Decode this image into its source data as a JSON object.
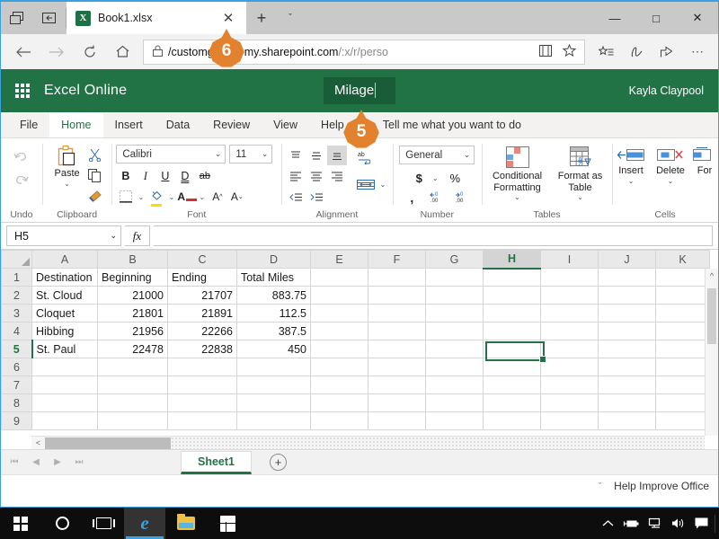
{
  "browser": {
    "tab": {
      "title": "Book1.xlsx",
      "icon": "excel-icon",
      "close": "✕"
    },
    "newtab_label": "+",
    "tab_menu_label": "ˇ",
    "window_controls": {
      "minimize": "—",
      "maximize": "□",
      "close": "✕"
    },
    "nav": {
      "back": "←",
      "forward": "→",
      "refresh": "↻",
      "home": "⌂"
    },
    "url": {
      "lock": "ὑ2",
      "domain": "/customguides-my.sharepoint.com",
      "path": "/:x/r/perso"
    },
    "url_icons": {
      "reading_view": "□",
      "favorite": "☆"
    },
    "toolbar_icons": {
      "favorites_list": "☆",
      "notes": "✎",
      "share": "⤴",
      "more": "⋯"
    }
  },
  "excel": {
    "brand": "Excel Online",
    "filename": "Milage",
    "user": "Kayla Claypool",
    "waffle": "app-launcher-icon",
    "tabs": [
      {
        "label": "File",
        "active": false
      },
      {
        "label": "Home",
        "active": true
      },
      {
        "label": "Insert",
        "active": false
      },
      {
        "label": "Data",
        "active": false
      },
      {
        "label": "Review",
        "active": false
      },
      {
        "label": "View",
        "active": false
      },
      {
        "label": "Help",
        "active": false
      }
    ],
    "tellme": "Tell me what you want to do",
    "ribbon": {
      "undo": {
        "label": "Undo",
        "undo_icon": "↶",
        "redo_icon": "↷"
      },
      "clipboard": {
        "label": "Clipboard",
        "paste": "Paste",
        "cut": "✂",
        "copy": "⧉",
        "format_painter": "✂"
      },
      "font": {
        "label": "Font",
        "family": "Calibri",
        "size": "11",
        "bold": "B",
        "italic": "I",
        "underline": "U",
        "double_underline": "D",
        "strikethrough": "ab",
        "borders": "▦",
        "fill_color": "A",
        "font_color": "A",
        "grow": "A",
        "shrink": "A"
      },
      "alignment": {
        "label": "Alignment",
        "top": "≡",
        "middle": "≡",
        "bottom": "≡",
        "left": "≡",
        "center": "≡",
        "right": "≡",
        "decrease_indent": "≡",
        "increase_indent": "≡",
        "wrap_text": "ab",
        "merge": "↔"
      },
      "number": {
        "label": "Number",
        "format": "General",
        "currency": "$",
        "percent": "%",
        "comma": ",",
        "increase_decimal": ".00",
        "decrease_decimal": ".00"
      },
      "tables": {
        "label": "Tables",
        "conditional_formatting": "Conditional Formatting",
        "format_as_table": "Format as Table"
      },
      "cells": {
        "label": "Cells",
        "insert": "Insert",
        "delete": "Delete",
        "format": "For"
      }
    },
    "formula_bar": {
      "name_box": "H5",
      "fx": "fx",
      "formula": ""
    },
    "grid": {
      "columns": [
        "A",
        "B",
        "C",
        "D",
        "E",
        "F",
        "G",
        "H",
        "I",
        "J",
        "K"
      ],
      "selected_column": "H",
      "selected_cell": "H5",
      "rows": [
        {
          "num": "1",
          "cells": [
            "Destination",
            "Beginning",
            "Ending",
            "Total Miles",
            "",
            "",
            "",
            "",
            "",
            "",
            ""
          ]
        },
        {
          "num": "2",
          "cells": [
            "St. Cloud",
            "21000",
            "21707",
            "883.75",
            "",
            "",
            "",
            "",
            "",
            "",
            ""
          ]
        },
        {
          "num": "3",
          "cells": [
            "Cloquet",
            "21801",
            "21891",
            "112.5",
            "",
            "",
            "",
            "",
            "",
            "",
            ""
          ]
        },
        {
          "num": "4",
          "cells": [
            "Hibbing",
            "21956",
            "22266",
            "387.5",
            "",
            "",
            "",
            "",
            "",
            "",
            ""
          ]
        },
        {
          "num": "5",
          "cells": [
            "St. Paul",
            "22478",
            "22838",
            "450",
            "",
            "",
            "",
            "",
            "",
            "",
            ""
          ]
        },
        {
          "num": "6",
          "cells": [
            "",
            "",
            "",
            "",
            "",
            "",
            "",
            "",
            "",
            "",
            ""
          ]
        },
        {
          "num": "7",
          "cells": [
            "",
            "",
            "",
            "",
            "",
            "",
            "",
            "",
            "",
            "",
            ""
          ]
        },
        {
          "num": "8",
          "cells": [
            "",
            "",
            "",
            "",
            "",
            "",
            "",
            "",
            "",
            "",
            ""
          ]
        },
        {
          "num": "9",
          "cells": [
            "",
            "",
            "",
            "",
            "",
            "",
            "",
            "",
            "",
            "",
            ""
          ]
        }
      ]
    },
    "sheet_tabs": {
      "nav": {
        "first": "⏮",
        "prev": "◀",
        "next": "▶",
        "last": "⏭"
      },
      "tabs": [
        {
          "label": "Sheet1",
          "active": true
        }
      ],
      "add": "+"
    },
    "status_bar": {
      "caret": "ˇ",
      "help": "Help Improve Office"
    }
  },
  "taskbar": {
    "items": [
      {
        "name": "start-button"
      },
      {
        "name": "cortana-button"
      },
      {
        "name": "task-view-button"
      },
      {
        "name": "edge-button",
        "active": true
      },
      {
        "name": "file-explorer-button"
      },
      {
        "name": "microsoft-store-button"
      }
    ],
    "tray": {
      "show_hidden": "˄",
      "power": "⬛",
      "network": "⬛",
      "volume": "◁",
      "action_center": "⬜"
    }
  },
  "callouts": [
    {
      "number": "6",
      "name": "callout-6"
    },
    {
      "number": "5",
      "name": "callout-5"
    }
  ],
  "colors": {
    "excel_green": "#217346",
    "excel_dark_green": "#195c38",
    "callout_orange": "#e2822e",
    "edge_blue": "#3aa0e0"
  }
}
